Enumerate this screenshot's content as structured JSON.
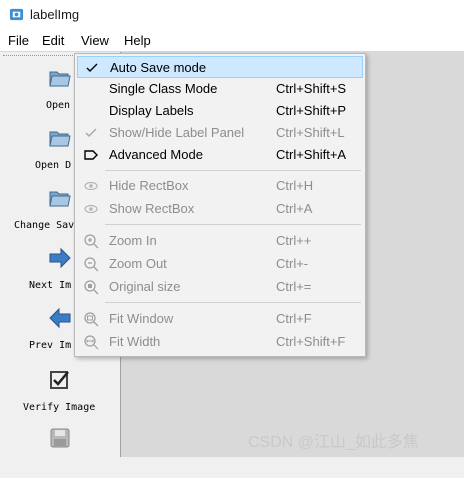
{
  "window": {
    "title": "labelImg"
  },
  "menubar": {
    "items": [
      "File",
      "Edit",
      "View",
      "Help"
    ]
  },
  "toolbar": {
    "items": [
      {
        "label": "Open",
        "icon": "folder-open-icon"
      },
      {
        "label": "Open D",
        "icon": "folder-open-icon"
      },
      {
        "label": "Change Sav",
        "icon": "folder-open-icon"
      },
      {
        "label": "Next Im",
        "icon": "arrow-right-icon"
      },
      {
        "label": "Prev Im",
        "icon": "arrow-left-icon"
      },
      {
        "label": "Verify Image",
        "icon": "checkbox-icon"
      },
      {
        "label": "",
        "icon": "save-icon"
      }
    ]
  },
  "view_menu": {
    "items": [
      {
        "label": "Auto Save mode",
        "shortcut": "",
        "checked": true,
        "enabled": true,
        "highlighted": true
      },
      {
        "label": "Single Class Mode",
        "shortcut": "Ctrl+Shift+S",
        "enabled": true
      },
      {
        "label": "Display Labels",
        "shortcut": "Ctrl+Shift+P",
        "enabled": true
      },
      {
        "label": "Show/Hide Label Panel",
        "shortcut": "Ctrl+Shift+L",
        "checked": true,
        "enabled": false
      },
      {
        "label": "Advanced Mode",
        "shortcut": "Ctrl+Shift+A",
        "enabled": true,
        "icon": "tag-icon"
      },
      {
        "label": "Hide RectBox",
        "shortcut": "Ctrl+H",
        "enabled": false,
        "icon": "eye-icon"
      },
      {
        "label": "Show RectBox",
        "shortcut": "Ctrl+A",
        "enabled": false,
        "icon": "eye-icon"
      },
      {
        "label": "Zoom In",
        "shortcut": "Ctrl++",
        "enabled": false,
        "icon": "zoom-in-icon"
      },
      {
        "label": "Zoom Out",
        "shortcut": "Ctrl+-",
        "enabled": false,
        "icon": "zoom-out-icon"
      },
      {
        "label": "Original size",
        "shortcut": "Ctrl+=",
        "enabled": false,
        "icon": "zoom-original-icon"
      },
      {
        "label": "Fit Window",
        "shortcut": "Ctrl+F",
        "enabled": false,
        "icon": "fit-window-icon"
      },
      {
        "label": "Fit Width",
        "shortcut": "Ctrl+Shift+F",
        "enabled": false,
        "icon": "fit-width-icon"
      }
    ]
  },
  "watermark": "CSDN @江山_如此多焦",
  "colors": {
    "highlight": "#cde8ff",
    "highlight_border": "#99d1ff",
    "disabled_text": "#8d8d8d",
    "accent_blue": "#2f6fb5"
  }
}
